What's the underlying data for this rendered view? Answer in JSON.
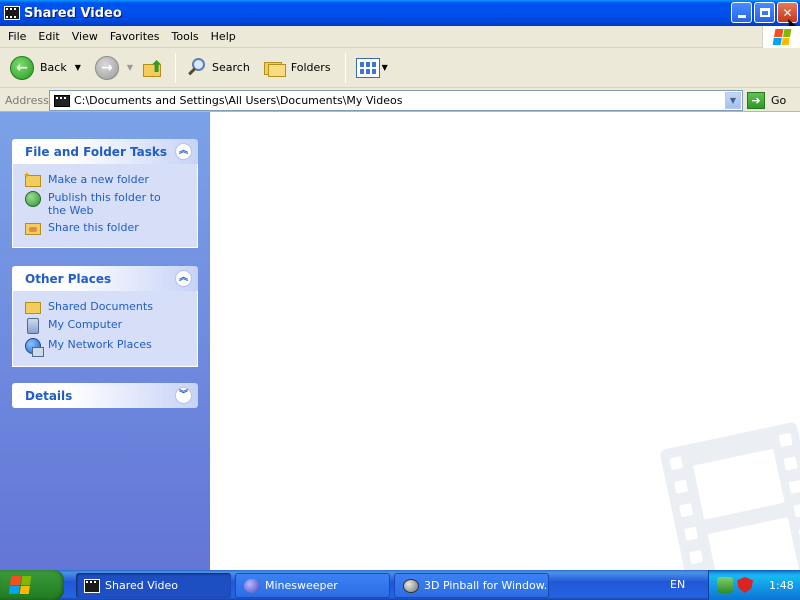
{
  "window": {
    "title": "Shared Video"
  },
  "menu": {
    "items": [
      {
        "label": "File"
      },
      {
        "label": "Edit"
      },
      {
        "label": "View"
      },
      {
        "label": "Favorites"
      },
      {
        "label": "Tools"
      },
      {
        "label": "Help"
      }
    ]
  },
  "toolbar": {
    "back_label": "Back",
    "search_label": "Search",
    "folders_label": "Folders"
  },
  "address": {
    "label": "Address",
    "value": "C:\\Documents and Settings\\All Users\\Documents\\My Videos",
    "go_label": "Go"
  },
  "taskpane": {
    "file_tasks": {
      "title": "File and Folder Tasks",
      "items": [
        {
          "label": "Make a new folder",
          "icon": "new-folder-icon"
        },
        {
          "label": "Publish this folder to the Web",
          "icon": "publish-web-icon"
        },
        {
          "label": "Share this folder",
          "icon": "share-folder-icon"
        }
      ]
    },
    "other_places": {
      "title": "Other Places",
      "items": [
        {
          "label": "Shared Documents",
          "icon": "folder-icon"
        },
        {
          "label": "My Computer",
          "icon": "computer-icon"
        },
        {
          "label": "My Network Places",
          "icon": "network-icon"
        }
      ]
    },
    "details": {
      "title": "Details"
    }
  },
  "taskbar": {
    "buttons": [
      {
        "label": "Shared Video",
        "icon": "video-folder-icon",
        "active": true
      },
      {
        "label": "Minesweeper",
        "icon": "minesweeper-icon",
        "active": false
      },
      {
        "label": "3D Pinball for Window...",
        "icon": "pinball-icon",
        "active": false
      }
    ],
    "language": "EN",
    "clock": "1:48"
  },
  "colors": {
    "titlebar": "#0050ee",
    "taskpane_link": "#215dc6",
    "taskpane_bg": "#6375d6",
    "start_green": "#2e8b2e"
  }
}
